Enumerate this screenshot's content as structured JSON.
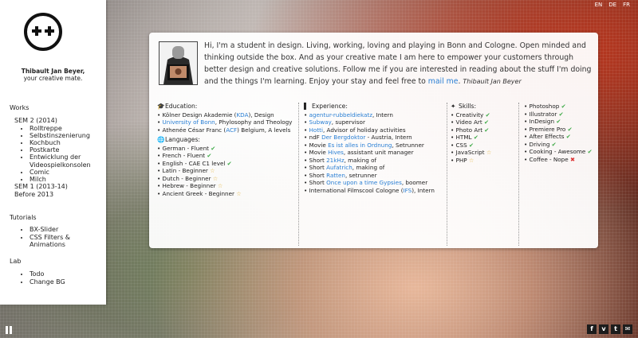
{
  "owner": {
    "name": "Thibault Jan Beyer,",
    "tagline": "your creative mate."
  },
  "languages": [
    "EN",
    "DE",
    "FR"
  ],
  "nav": {
    "works_heading": "Works",
    "sem2": "SEM 2 (2014)",
    "sem2_items": [
      "Rolltreppe",
      "Selbstinszenierung",
      "Kochbuch",
      "Postkarte",
      "Entwicklung der",
      "Videospielkonsolen",
      "Comic",
      "Milch"
    ],
    "sem1": "SEM 1 (2013-14)",
    "before": "Before 2013",
    "tutorials_heading": "Tutorials",
    "tutorials_items": [
      "BX-Slider",
      "CSS Filters &",
      "Animations"
    ],
    "lab_heading": "Lab",
    "lab_items": [
      "Todo",
      "Change BG"
    ]
  },
  "intro": {
    "text": "Hi, I'm a student in design. Living, working, loving and playing in Bonn and Cologne. Open minded and thinking outside the box. And as your creative mate I am here to empower your customers through better design and creative solutions. Follow me if you are interested in reading about the stuff I'm doing and the things I'm learning. Enjoy your stay and feel free to ",
    "link": "mail me",
    "end": ".",
    "signature": "Thibault Jan Beyer"
  },
  "education": {
    "title": "Education:",
    "items": [
      {
        "pre": "Kölner Design Akademie (",
        "hl": "KDA",
        "post": "), Design"
      },
      {
        "pre": "",
        "hl": "University of Bonn",
        "post": ", Phylosophy and Theology"
      },
      {
        "pre": "Athenée César Franc (",
        "hl": "ACF",
        "post": ") Belgium, A levels"
      }
    ]
  },
  "lang_skills": {
    "title": "Languages:",
    "items": [
      {
        "text": "German - Fluent",
        "mark": "check"
      },
      {
        "text": "French - Fluent",
        "mark": "check"
      },
      {
        "text": "English - CAE C1 level",
        "mark": "check"
      },
      {
        "text": "Latin - Beginner",
        "mark": "star"
      },
      {
        "text": "Dutch - Beginner",
        "mark": "star"
      },
      {
        "text": "Hebrew - Beginner",
        "mark": "star"
      },
      {
        "text": "Ancient Greek - Beginner",
        "mark": "star"
      }
    ]
  },
  "experience": {
    "title": "Experience:",
    "items": [
      {
        "pre": "",
        "hl": "agentur-rubbeldiekatz",
        "post": ", Intern"
      },
      {
        "pre": "",
        "hl": "Subway",
        "post": ", supervisor"
      },
      {
        "pre": "",
        "hl": "Hotti",
        "post": ", Advisor of holiday activities"
      },
      {
        "pre": "ndF ",
        "hl": "Der Bergdoktor",
        "post": " - Austria, Intern"
      },
      {
        "pre": "Movie ",
        "hl": "Es ist alles in Ordnung",
        "post": ", Setrunner"
      },
      {
        "pre": "Movie ",
        "hl": "Hives",
        "post": ", assistant unit manager"
      },
      {
        "pre": "Short ",
        "hl": "21kHz",
        "post": ", making of"
      },
      {
        "pre": "Short ",
        "hl": "Aufatrich",
        "post": ", making of"
      },
      {
        "pre": "Short ",
        "hl": "Ratten",
        "post": ", setrunner"
      },
      {
        "pre": "Short ",
        "hl": "Once upon a time Gypsies",
        "post": ", boomer"
      },
      {
        "pre": "International Filmscool Cologne (",
        "hl": "IFS",
        "post": "), Intern"
      }
    ]
  },
  "skills": {
    "title": "Skills:",
    "col1": [
      {
        "text": "Creativity",
        "mark": "check"
      },
      {
        "text": "Video Art",
        "mark": "check"
      },
      {
        "text": "Photo Art",
        "mark": "check"
      },
      {
        "text": "HTML",
        "mark": "check"
      },
      {
        "text": "CSS",
        "mark": "check"
      },
      {
        "text": "JavaScript",
        "mark": "star"
      },
      {
        "text": "PHP",
        "mark": "star"
      }
    ],
    "col2": [
      {
        "text": "Photoshop",
        "mark": "check"
      },
      {
        "text": "Illustrator",
        "mark": "check"
      },
      {
        "text": "InDesign",
        "mark": "check"
      },
      {
        "text": "Premiere Pro",
        "mark": "check"
      },
      {
        "text": "After Effects",
        "mark": "check"
      },
      {
        "text": "Driving",
        "mark": "check"
      },
      {
        "text": "Cooking - Awesome",
        "mark": "check"
      },
      {
        "text": "Coffee - Nope",
        "mark": "cross"
      }
    ]
  },
  "social_icons": [
    "facebook-icon",
    "vimeo-icon",
    "twitter-icon",
    "mail-icon"
  ],
  "colors": {
    "link": "#2a7fd4",
    "check": "#3aa843",
    "star": "#e5b84a",
    "cross": "#dd3333"
  }
}
